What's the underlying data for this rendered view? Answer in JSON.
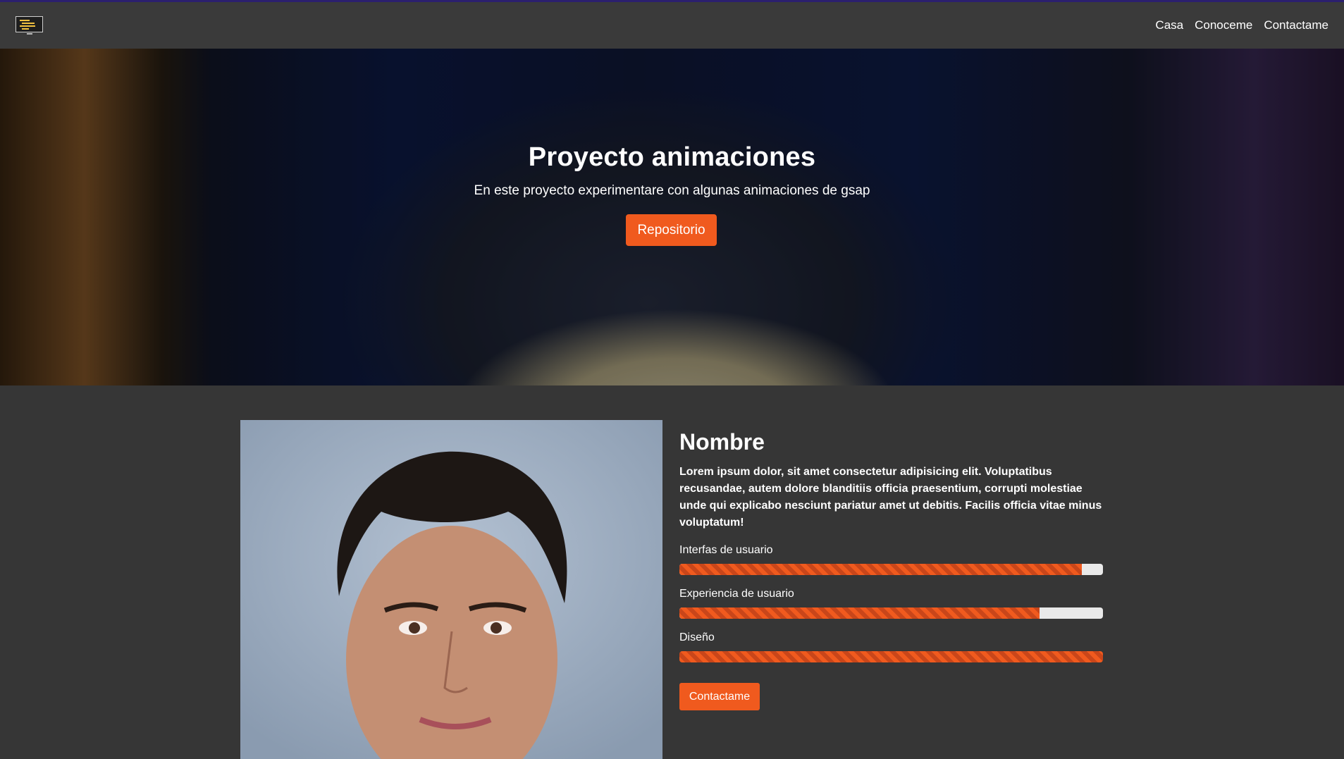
{
  "navbar": {
    "logo_icon": "monitor-code-icon",
    "links": [
      {
        "label": "Casa"
      },
      {
        "label": "Conoceme"
      },
      {
        "label": "Contactame"
      }
    ]
  },
  "hero": {
    "title": "Proyecto animaciones",
    "subtitle": "En este proyecto experimentare con algunas animaciones de gsap",
    "button_label": "Repositorio"
  },
  "about": {
    "photo_icon": "portrait-photo",
    "name": "Nombre",
    "bio": "Lorem ipsum dolor, sit amet consectetur adipisicing elit. Voluptatibus recusandae, autem dolore blanditiis officia praesentium, corrupti molestiae unde qui explicabo nesciunt pariatur amet ut debitis. Facilis officia vitae minus voluptatum!",
    "skills": [
      {
        "label": "Interfas de usuario",
        "percent": 95
      },
      {
        "label": "Experiencia de usuario",
        "percent": 85
      },
      {
        "label": "Diseño",
        "percent": 100
      }
    ],
    "contact_label": "Contactame"
  },
  "colors": {
    "accent": "#f05a1e",
    "background": "#363636",
    "navbar": "#3a3a3a"
  }
}
